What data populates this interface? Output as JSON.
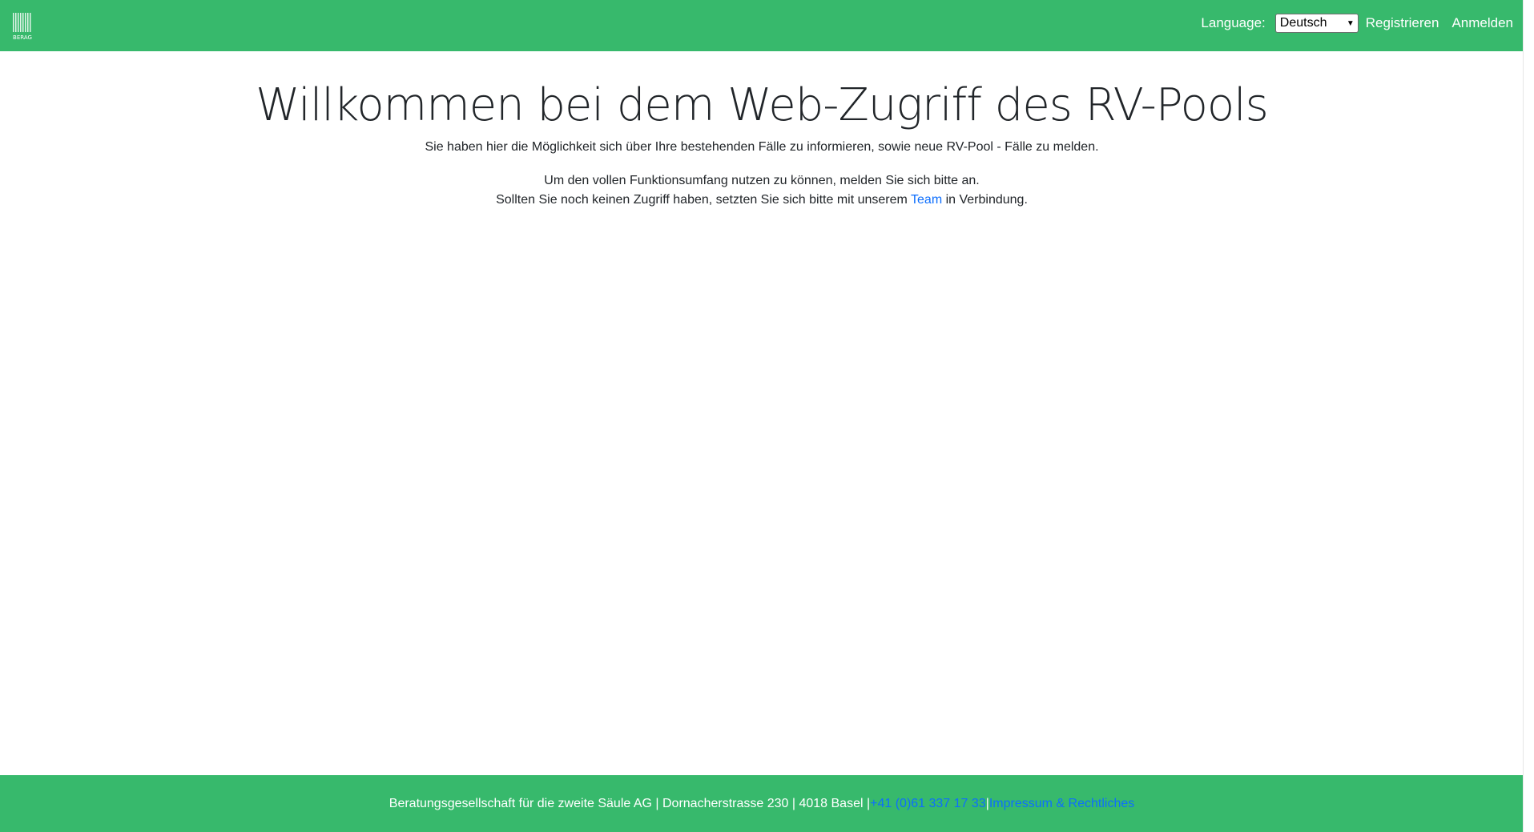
{
  "header": {
    "logo_text": "BERAG",
    "language_label": "Language:",
    "language_selected": "Deutsch",
    "register_label": "Registrieren",
    "login_label": "Anmelden"
  },
  "main": {
    "title": "Willkommen bei dem Web-Zugriff des RV-Pools",
    "subtitle": "Sie haben hier die Möglichkeit sich über Ihre bestehenden Fälle zu informieren, sowie neue RV-Pool - Fälle zu melden.",
    "info_line1": "Um den vollen Funktionsumfang nutzen zu können, melden Sie sich bitte an.",
    "info_line2_before": "Sollten Sie noch keinen Zugriff haben, setzten Sie sich bitte mit unserem ",
    "info_line2_link": "Team",
    "info_line2_after": " in Verbindung."
  },
  "footer": {
    "company_text": "Beratungsgesellschaft für die zweite Säule AG | Dornacherstrasse 230 | 4018 Basel | ",
    "phone": "+41 (0)61 337 17 33",
    "separator": " | ",
    "imprint_link": "Impressum & Rechtliches"
  },
  "colors": {
    "brand_green": "#37b96c",
    "link_blue": "#0d6efd",
    "text_dark": "#212529"
  }
}
